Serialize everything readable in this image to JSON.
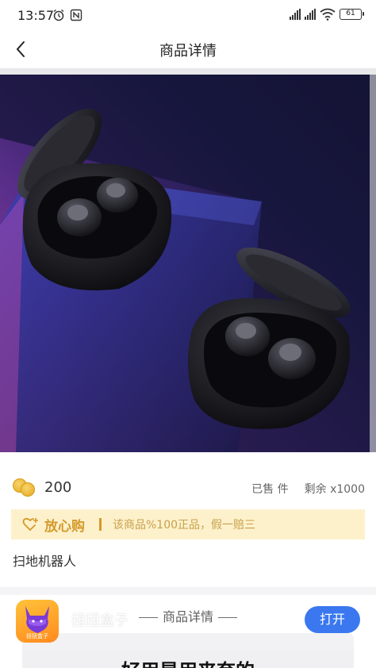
{
  "status_bar": {
    "time": "13:57",
    "battery": "61",
    "left_icons": [
      "alarm-icon",
      "nfc-icon"
    ],
    "right_icons": [
      "hd-signal-icon",
      "hd-signal-icon",
      "wifi-icon",
      "battery-icon"
    ]
  },
  "nav": {
    "title": "商品详情",
    "back_icon": "back-arrow-icon"
  },
  "product": {
    "price": "200",
    "sold_label": "已售 件",
    "remaining_label": "剩余 x1000",
    "name": "扫地机器人",
    "image_icon": "product-image"
  },
  "assurance": {
    "title": "放心购",
    "text": "该商品%100正品，假一赔三",
    "icon": "heart-plus-icon",
    "color": "#d49a2b",
    "background": "#fdf1cc"
  },
  "details": {
    "heading": "商品详情",
    "text": "好用是用来夸的"
  },
  "app_banner": {
    "name": "扭扭盒子",
    "logo_label": "扭扭盒子",
    "open_label": "打开",
    "button_color": "#3b78f0"
  }
}
